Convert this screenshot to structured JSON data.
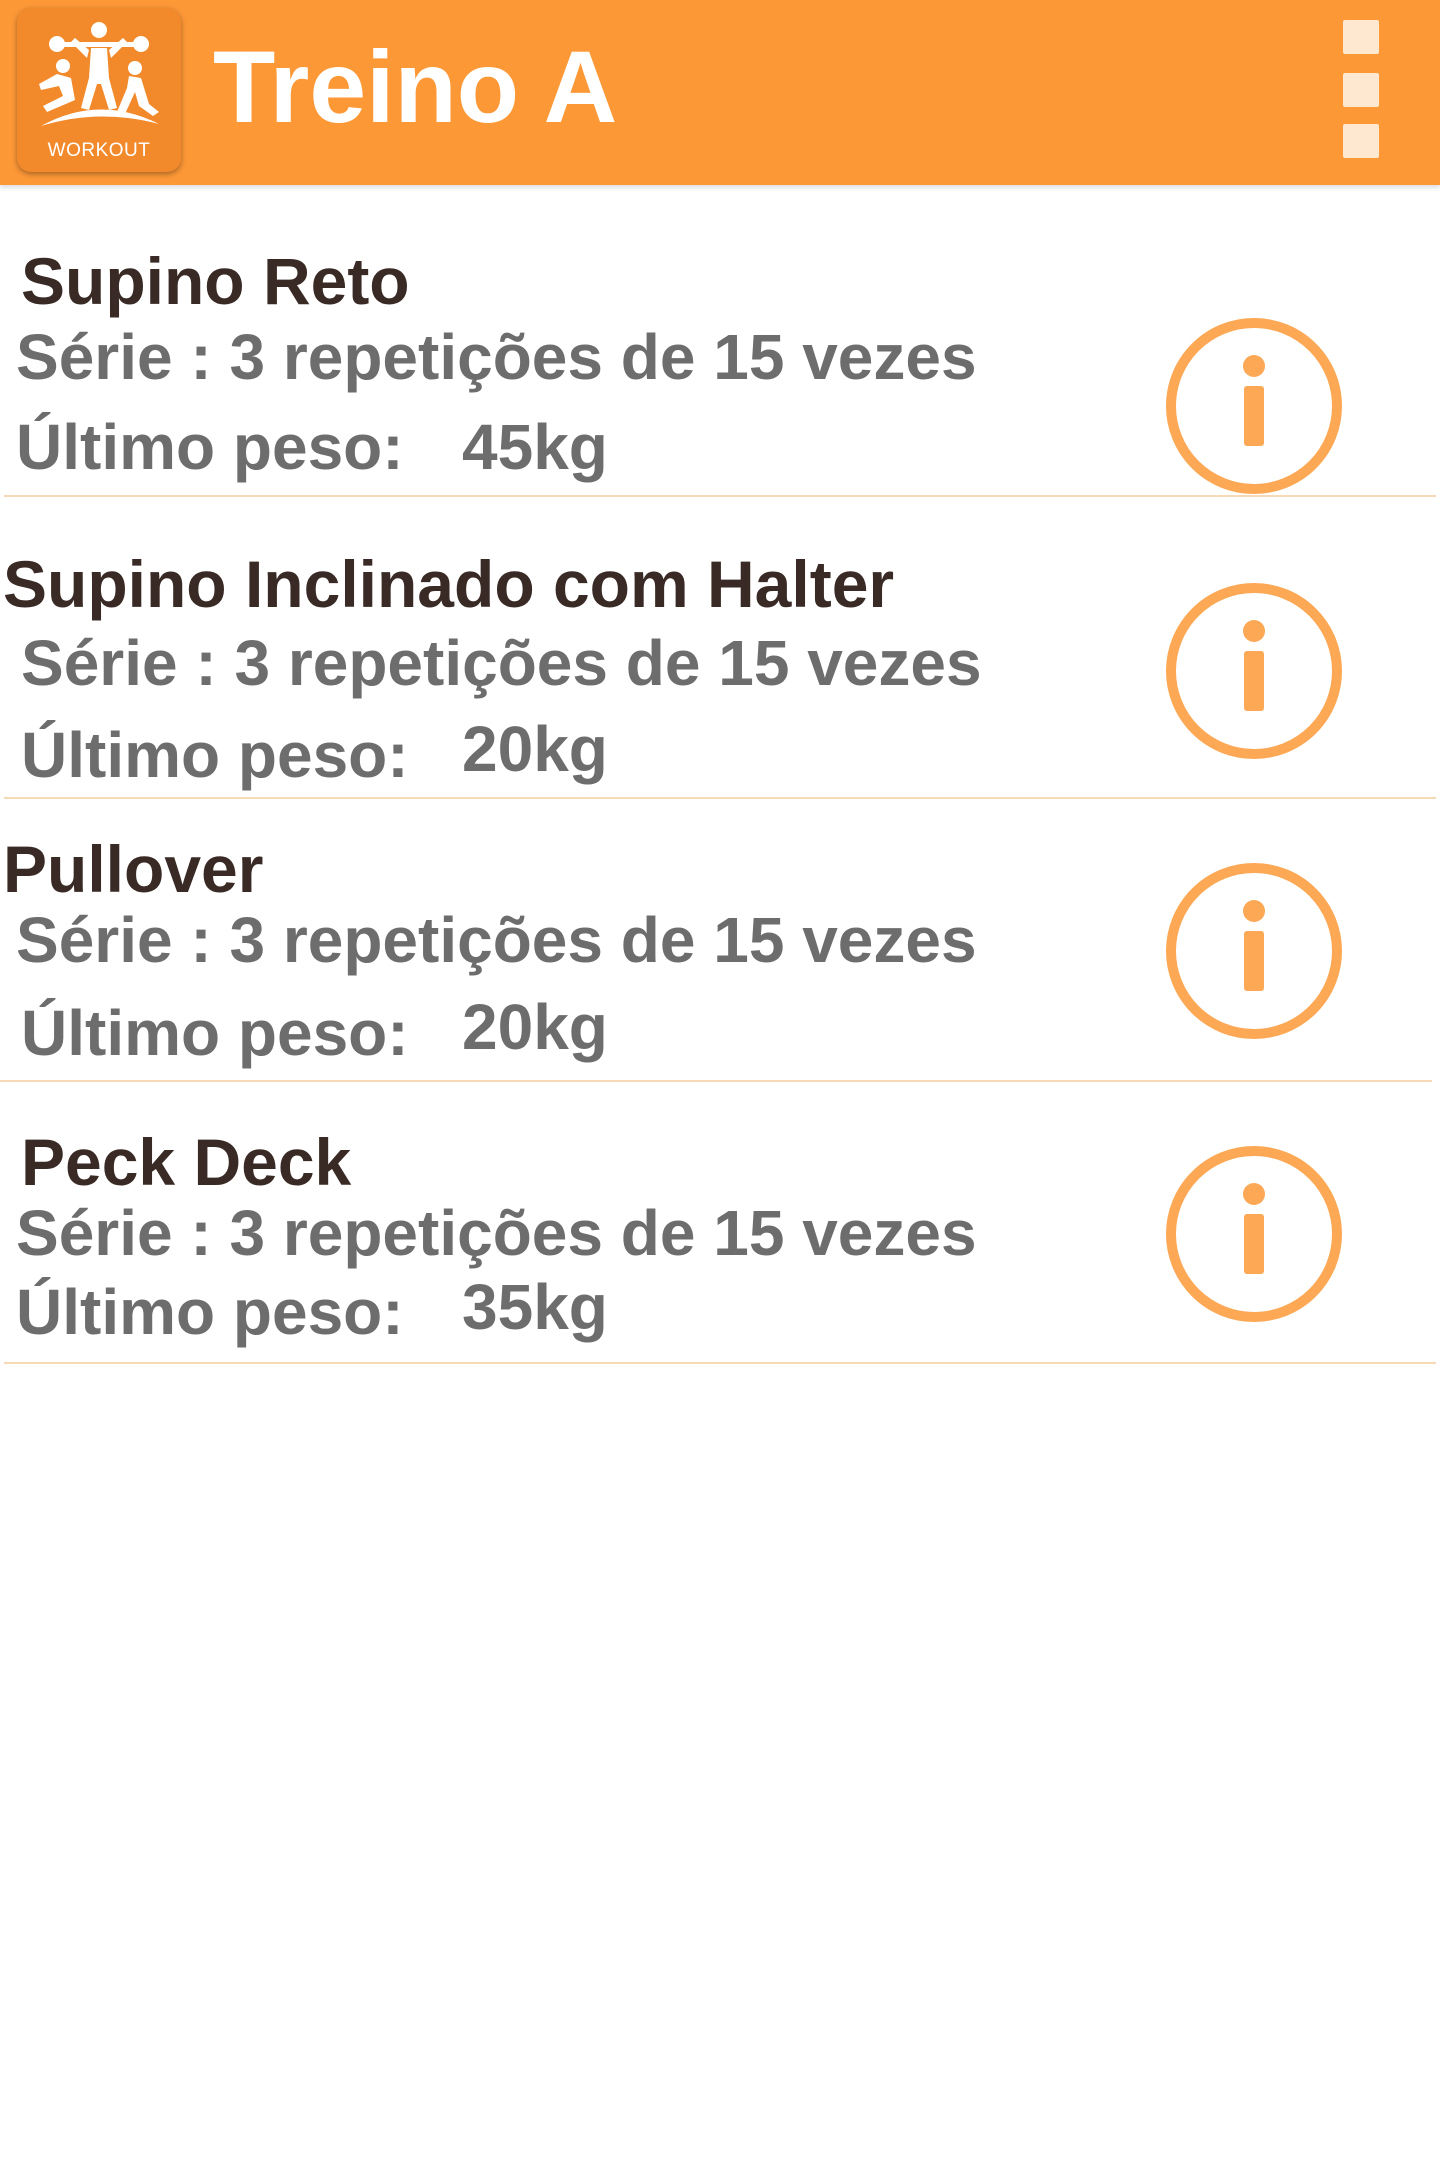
{
  "app_bar": {
    "logo_text": "WORKOUT",
    "title": "Treino A",
    "background_color": "#fd9837",
    "menu_icon": "overflow-menu-icon"
  },
  "exercises": [
    {
      "name": "Supino Reto",
      "series": "Série : 3 repetições de 15 vezes",
      "weight_label": "Último peso:",
      "weight_value": "45kg",
      "info_icon": "info-icon"
    },
    {
      "name": "Supino Inclinado com Halter",
      "series": "Série : 3 repetições de 15 vezes",
      "weight_label": "Último peso:",
      "weight_value": "20kg",
      "info_icon": "info-icon"
    },
    {
      "name": "Pullover",
      "series": "Série : 3 repetições de 15 vezes",
      "weight_label": "Último peso:",
      "weight_value": "20kg",
      "info_icon": "info-icon"
    },
    {
      "name": "Peck Deck",
      "series": "Série : 3 repetições de 15 vezes",
      "weight_label": "Último peso:",
      "weight_value": "35kg",
      "info_icon": "info-icon"
    }
  ],
  "colors": {
    "accent": "#fd9837",
    "info_icon": "#fca855",
    "title_text": "#3a2a25",
    "body_text": "#6d6d6d",
    "divider": "#f8d9b6"
  }
}
